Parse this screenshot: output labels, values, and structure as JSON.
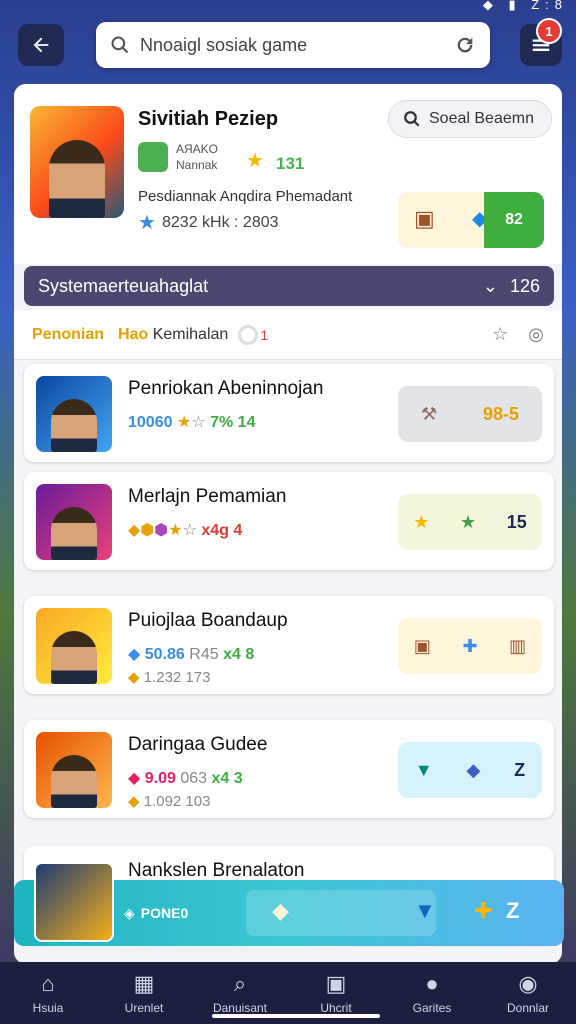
{
  "status_bar": {
    "icons": "◆ ▮ Z:8"
  },
  "top_bar": {
    "search_value": "Nnoaigl sosiak game"
  },
  "notifications": {
    "count": "1"
  },
  "featured": {
    "title": "Sivitiah Peziep",
    "tag_line1": "AЯAKO",
    "tag_line2": "Nannak",
    "rating": "131",
    "subtitle": "Pesdiannak Anqdira Phemadant",
    "stats": "8232 kHk : 2803",
    "social_button": "Soeal Beaemn",
    "action_value": "82"
  },
  "section": {
    "title": "Systemaerteuahaglat",
    "count": "126"
  },
  "filters": {
    "first": "Penonian",
    "second_prefix": "Hao",
    "second_rest": "Kemihalan",
    "toggle_num": "1"
  },
  "rows": [
    {
      "name": "Penriokan Abeninnojan",
      "s1a": "10060",
      "s1b": "7% 14",
      "s2": "",
      "action": "98-5",
      "colors": {
        "avatar": "#1976d2",
        "action_bg": "#e3e4e8"
      }
    },
    {
      "name": "Merlajn Pemamian",
      "s1a": "",
      "s1b": "x4g 4",
      "s2": "",
      "action": "15",
      "colors": {
        "avatar": "#8e24aa",
        "action_bg": "#f4f6dc"
      }
    },
    {
      "name": "Puiojlaa Boandaup",
      "s1a": "50.86",
      "s1m": "R45",
      "s1b": "x4 8",
      "s2": "1.232 173",
      "action": "",
      "colors": {
        "avatar": "#f9a825",
        "action_bg": "#fff5db"
      }
    },
    {
      "name": "Daringaa Gudee",
      "s1a": "9.09",
      "s1m": "063",
      "s1b": "x4 3",
      "s2": "1.092 103",
      "action": "",
      "colors": {
        "avatar": "#ef6c00",
        "action_bg": "#d6f3fb"
      }
    },
    {
      "name": "Nankslen Brenalaton"
    }
  ],
  "bottom_banner": {
    "label": "PONE0"
  },
  "nav": [
    {
      "label": "Hsuia",
      "icon": "home-icon"
    },
    {
      "label": "Urenlet",
      "icon": "store-icon"
    },
    {
      "label": "Danuisant",
      "icon": "search-icon"
    },
    {
      "label": "Uhcrit",
      "icon": "inbox-icon"
    },
    {
      "label": "Garites",
      "icon": "person-icon"
    },
    {
      "label": "Donnlar",
      "icon": "profile-icon"
    }
  ]
}
